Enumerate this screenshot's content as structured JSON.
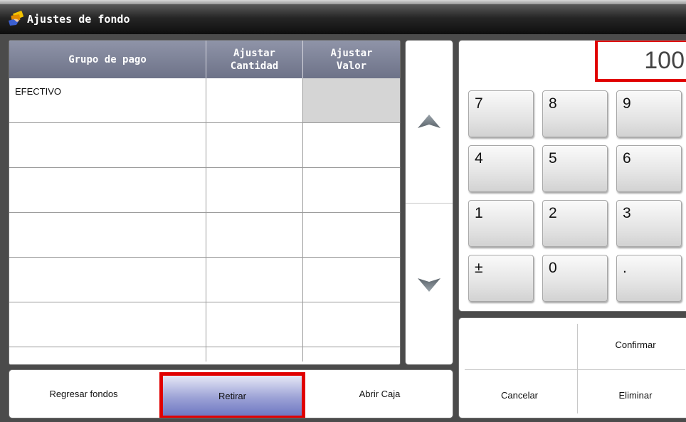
{
  "window": {
    "title": "Ajustes de fondo"
  },
  "grid": {
    "headers": {
      "grupo": "Grupo de pago",
      "cantidad_l1": "Ajustar",
      "cantidad_l2": "Cantidad",
      "valor_l1": "Ajustar",
      "valor_l2": "Valor"
    },
    "rows": [
      {
        "grupo": "EFECTIVO",
        "cantidad": "",
        "valor": ""
      },
      {
        "grupo": "",
        "cantidad": "",
        "valor": ""
      },
      {
        "grupo": "",
        "cantidad": "",
        "valor": ""
      },
      {
        "grupo": "",
        "cantidad": "",
        "valor": ""
      },
      {
        "grupo": "",
        "cantidad": "",
        "valor": ""
      },
      {
        "grupo": "",
        "cantidad": "",
        "valor": ""
      }
    ]
  },
  "keypad": {
    "display": "100",
    "keys": [
      "7",
      "8",
      "9",
      "4",
      "5",
      "6",
      "1",
      "2",
      "3",
      "±",
      "0",
      "."
    ]
  },
  "actions": {
    "confirmar": "Confirmar",
    "cancelar": "Cancelar",
    "eliminar": "Eliminar"
  },
  "bottom": {
    "regresar": "Regresar fondos",
    "retirar": "Retirar",
    "abrir": "Abrir Caja"
  },
  "colors": {
    "highlight": "#e00000",
    "header_bg": "#7d8297",
    "selected_cell": "#d5d5d5",
    "retirar_bg": "#8e96d0"
  },
  "icons": {
    "app": "money-hand-icon",
    "up": "arrow-up-icon",
    "down": "arrow-down-icon"
  }
}
